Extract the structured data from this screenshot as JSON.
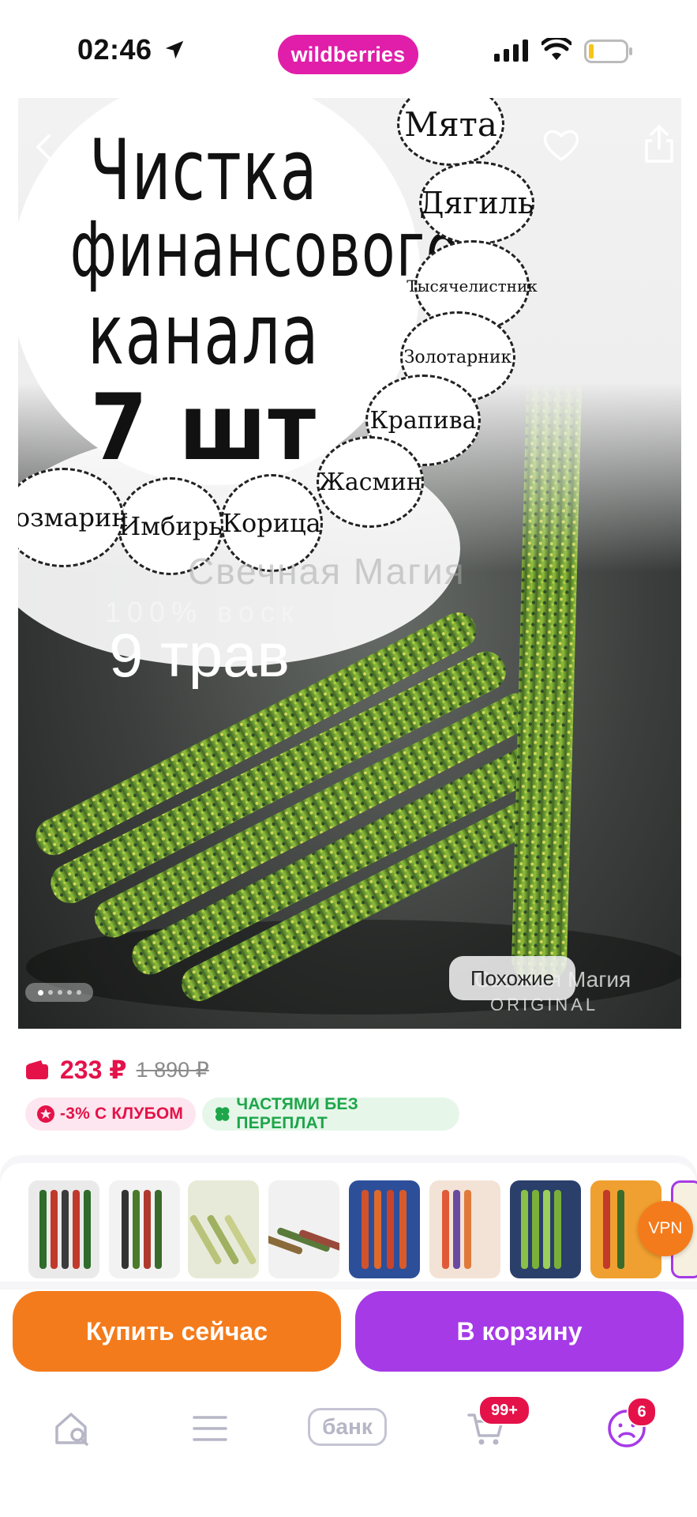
{
  "status_bar": {
    "time": "02:46",
    "brand": "wildberries",
    "icons": [
      "location-arrow-icon",
      "signal-icon",
      "wifi-icon",
      "battery-icon"
    ]
  },
  "hero": {
    "title_lines": [
      "Чистка",
      "финансового",
      "канала",
      "7 шт"
    ],
    "herbs": [
      "Мята",
      "Дягиль",
      "Тысячелистник",
      "Золотарник",
      "Крапива",
      "Жасмин",
      "Корица",
      "Имбирь",
      "Розмарин"
    ],
    "wax_text": "100% воск",
    "herb_count_text": "9 трав",
    "watermark": "Свечная Магия",
    "watermark_small": "Свечная Магия",
    "original_label": "ORIGINAL",
    "similar_button": "Похожие",
    "page_dots": 5,
    "active_dot": 1,
    "icons": [
      "back-chevron-icon",
      "heart-icon",
      "share-icon"
    ]
  },
  "price": {
    "current": "233 ₽",
    "old": "1 890 ₽",
    "badges": {
      "club": "-3% С КЛУБОМ",
      "parts": "ЧАСТЯМИ БЕЗ ПЕРЕПЛАТ"
    }
  },
  "variants": {
    "count": 9,
    "vpn_label": "VPN"
  },
  "actions": {
    "buy_now": "Купить сейчас",
    "add_to_cart": "В корзину"
  },
  "tab_bar": {
    "bank_label": "банк",
    "cart_badge": "99+",
    "profile_badge": "6"
  },
  "colors": {
    "brand": "#e01ea9",
    "price": "#e5124a",
    "buy": "#f47b1c",
    "cart": "#a53ae6",
    "parts_badge": "#1ea64a"
  }
}
